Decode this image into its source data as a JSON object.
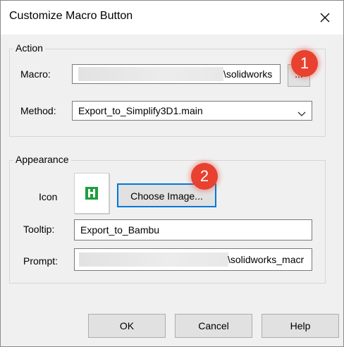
{
  "window": {
    "title": "Customize Macro Button"
  },
  "action": {
    "legend": "Action",
    "macro_label": "Macro:",
    "macro_value_suffix": "\\solidworks",
    "browse_label": "...",
    "method_label": "Method:",
    "method_value": "Export_to_Simplify3D1.main"
  },
  "appearance": {
    "legend": "Appearance",
    "icon_label": "Icon",
    "choose_image_label": "Choose Image...",
    "tooltip_label": "Tooltip:",
    "tooltip_value": "Export_to_Bambu",
    "prompt_label": "Prompt:",
    "prompt_value_suffix": "\\solidworks_macr"
  },
  "badges": {
    "one": "1",
    "two": "2"
  },
  "buttons": {
    "ok": "OK",
    "cancel": "Cancel",
    "help": "Help"
  },
  "colors": {
    "badge": "#e8412f",
    "accent_border": "#0078d7",
    "icon_green": "#1e9e3e"
  }
}
